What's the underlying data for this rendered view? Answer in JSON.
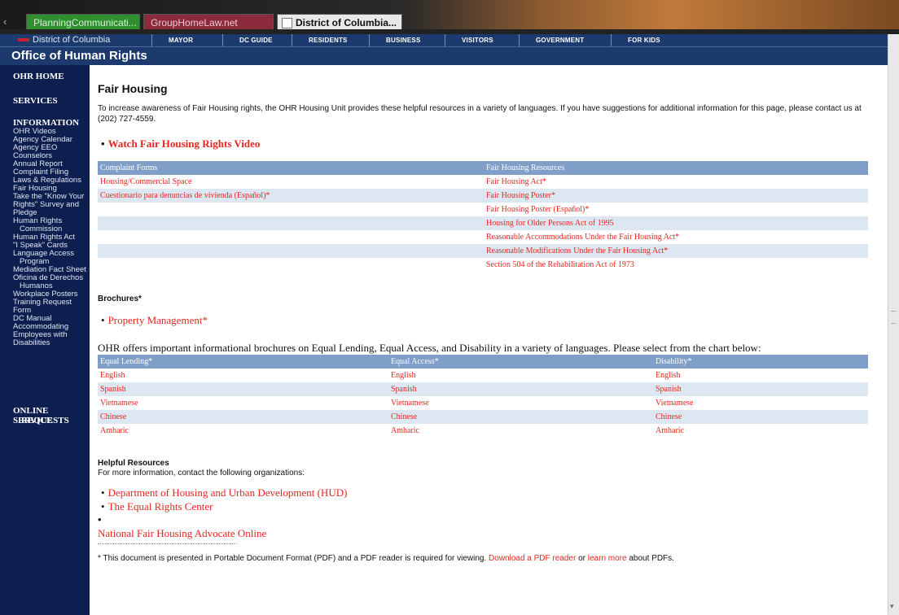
{
  "browser": {
    "tabs": [
      {
        "label": "PlanningCommunicati..."
      },
      {
        "label": "GroupHomeLaw.net"
      },
      {
        "label": "District of Columbia..."
      }
    ]
  },
  "dc_header": {
    "label": "District of Columbia",
    "nav": [
      "MAYOR",
      "DC GUIDE",
      "RESIDENTS",
      "BUSINESS",
      "VISITORS",
      "GOVERNMENT",
      "FOR KIDS"
    ],
    "office": "Office of Human Rights"
  },
  "sidebar": {
    "ohr_home": "OHR HOME",
    "services": "SERVICES",
    "information": "INFORMATION",
    "links": [
      "OHR Videos",
      "Agency Calendar",
      "Agency EEO",
      "Counselors",
      "Annual Report",
      "Complaint Filing",
      "Laws & Regulations",
      "Fair Housing",
      "Take the \"Know Your",
      "Rights\" Survey and",
      "Pledge",
      "Human Rights",
      "Commission",
      "Human Rights Act",
      "\"I Speak\" Cards",
      "Language Access",
      "Program",
      "Mediation Fact Sheet",
      "Oficina de Derechos",
      "Humanos",
      "Workplace Posters",
      "Training Request",
      "Form",
      "DC Manual",
      "Accommodating",
      "Employees with",
      "Disabilities"
    ],
    "online_1": "ONLINE SERVICE",
    "online_2": "REQUESTS"
  },
  "main": {
    "title": "Fair Housing",
    "intro": "To increase awareness of Fair Housing rights, the OHR Housing Unit provides these helpful resources in a variety of languages. If you have suggestions for additional information for this page, please contact us at (202) 727-4559.",
    "video_link": "Watch Fair Housing Rights Video",
    "resources_table": {
      "headers": [
        "Complaint Forms",
        "Fair Housing Resources"
      ],
      "rows": [
        [
          "Housing/Commercial Space",
          "Fair Housing Act*"
        ],
        [
          "Cuestionario para denuncias de vivienda (Español)*",
          "Fair Housing Poster*"
        ],
        [
          "",
          "Fair Housing Poster (Español)*"
        ],
        [
          "",
          "Housing for Older Persons Act of 1995"
        ],
        [
          "",
          "Reasonable Accommodations Under the Fair Housing Act*"
        ],
        [
          "",
          "Reasonable Modifications Under the Fair Housing Act*"
        ],
        [
          "",
          "Section 504 of the Rehabilitation Act of 1973"
        ]
      ]
    },
    "brochures_heading": "Brochures*",
    "property_management": "Property Management*",
    "offers_text": "OHR offers important informational brochures on Equal Lending, Equal Access, and Disability in a variety of languages. Please select from the chart below:",
    "language_table": {
      "headers": [
        "Equal Lending*",
        "Equal Access*",
        "Disability*"
      ],
      "rows": [
        [
          "English",
          "English",
          "English"
        ],
        [
          "Spanish",
          "Spanish",
          "Spanish"
        ],
        [
          "Vietnamese",
          "Vietnamese",
          "Vietnamese"
        ],
        [
          "Chinese",
          "Chinese",
          "Chinese"
        ],
        [
          "Amharic",
          "Amharic",
          "Amharic"
        ]
      ]
    },
    "helpful_heading": "Helpful Resources",
    "helpful_sub": "For more information, contact the following organizations:",
    "orgs": [
      "Department of Housing and Urban Development (HUD)",
      "The Equal Rights Center"
    ],
    "org_extra": "National Fair Housing Advocate Online",
    "footnote_pre": "* This document is presented in Portable Document Format (PDF) and a PDF reader is required for viewing. ",
    "footnote_link1": "Download a PDF reader",
    "footnote_mid": " or ",
    "footnote_link2": "learn more",
    "footnote_post": " about PDFs."
  }
}
